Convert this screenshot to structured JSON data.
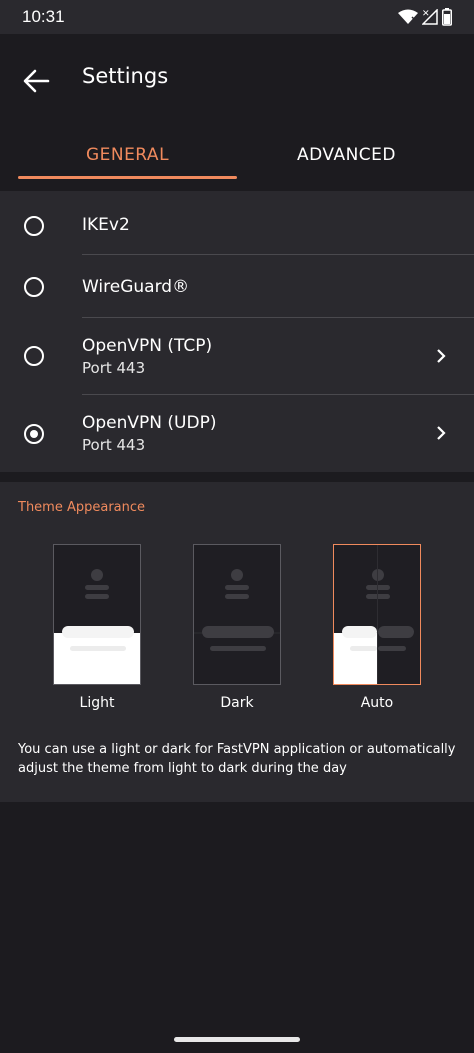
{
  "status": {
    "time": "10:31"
  },
  "header": {
    "title": "Settings"
  },
  "tabs": [
    {
      "label": "GENERAL",
      "active": true
    },
    {
      "label": "ADVANCED",
      "active": false
    }
  ],
  "protocols": [
    {
      "name": "IKEv2",
      "selected": false
    },
    {
      "name": "WireGuard®",
      "selected": false
    },
    {
      "name": "OpenVPN (TCP)",
      "port": "Port 443",
      "selected": false
    },
    {
      "name": "OpenVPN (UDP)",
      "port": "Port 443",
      "selected": true
    }
  ],
  "theme": {
    "title": "Theme Appearance",
    "options": [
      {
        "label": "Light",
        "selected": false
      },
      {
        "label": "Dark",
        "selected": false
      },
      {
        "label": "Auto",
        "selected": true
      }
    ],
    "description": "You can use a light or dark for FastVPN application or automatically adjust the theme from light to dark during the day"
  },
  "colors": {
    "accent": "#f08a5d",
    "background": "#1c1b1f",
    "surface": "#2a292e"
  }
}
